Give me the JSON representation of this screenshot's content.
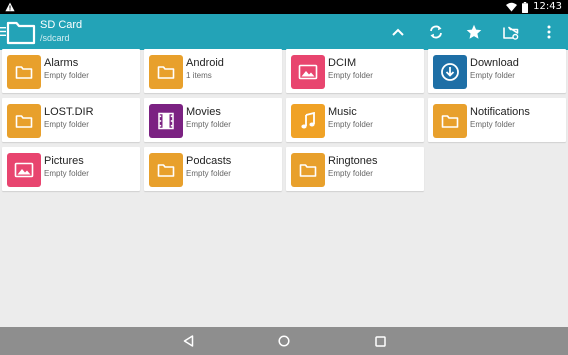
{
  "status_bar": {
    "time": "12:43",
    "icons": [
      "warning-icon",
      "wifi-icon",
      "battery-icon"
    ]
  },
  "app_bar": {
    "title": "SD Card",
    "path": "/sdcard",
    "actions": [
      "up-icon",
      "refresh-icon",
      "star-icon",
      "new-folder-icon",
      "more-icon"
    ]
  },
  "folders": [
    {
      "name": "Alarms",
      "meta": "Empty folder",
      "icon": "folder-icon",
      "color": "#e8a02c"
    },
    {
      "name": "Android",
      "meta": "1 items",
      "icon": "folder-icon",
      "color": "#e8a02c"
    },
    {
      "name": "DCIM",
      "meta": "Empty folder",
      "icon": "image-icon",
      "color": "#e8456f"
    },
    {
      "name": "Download",
      "meta": "Empty folder",
      "icon": "download-icon",
      "color": "#1e6fa6"
    },
    {
      "name": "LOST.DIR",
      "meta": "Empty folder",
      "icon": "folder-icon",
      "color": "#e8a02c"
    },
    {
      "name": "Movies",
      "meta": "Empty folder",
      "icon": "film-icon",
      "color": "#7b2282"
    },
    {
      "name": "Music",
      "meta": "Empty folder",
      "icon": "music-icon",
      "color": "#f0a226"
    },
    {
      "name": "Notifications",
      "meta": "Empty folder",
      "icon": "folder-icon",
      "color": "#e8a02c"
    },
    {
      "name": "Pictures",
      "meta": "Empty folder",
      "icon": "image-icon",
      "color": "#e8456f"
    },
    {
      "name": "Podcasts",
      "meta": "Empty folder",
      "icon": "folder-icon",
      "color": "#e8a02c"
    },
    {
      "name": "Ringtones",
      "meta": "Empty folder",
      "icon": "folder-icon",
      "color": "#e8a02c"
    }
  ],
  "nav_bar": {
    "buttons": [
      "back-icon",
      "home-icon",
      "recents-icon"
    ]
  },
  "colors": {
    "accent": "#23a3b7",
    "background": "#ececec"
  }
}
